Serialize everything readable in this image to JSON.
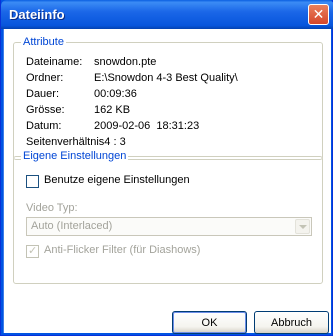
{
  "window": {
    "title": "Dateiinfo"
  },
  "attributes": {
    "legend": "Attribute",
    "rows": [
      {
        "label": "Dateiname:",
        "value": "snowdon.pte"
      },
      {
        "label": "Ordner:",
        "value": "E:\\Snowdon 4-3 Best Quality\\"
      },
      {
        "label": "Dauer:",
        "value": "00:09:36"
      },
      {
        "label": "Grösse:",
        "value": "162 KB"
      },
      {
        "label": "Datum:",
        "value": "2009-02-06  18:31:23"
      }
    ],
    "aspect_label": "Seitenverhältnis",
    "aspect_value": "4 : 3"
  },
  "settings": {
    "legend": "Eigene Einstellungen",
    "own_settings_label": "Benutze eigene Einstellungen",
    "own_settings_checked": false,
    "video_type_label": "Video Typ:",
    "video_type_value": "Auto (Interlaced)",
    "antiflicker_label": "Anti-Flicker Filter (für Diashows)",
    "antiflicker_checked": true
  },
  "buttons": {
    "ok": "OK",
    "cancel": "Abbruch"
  }
}
